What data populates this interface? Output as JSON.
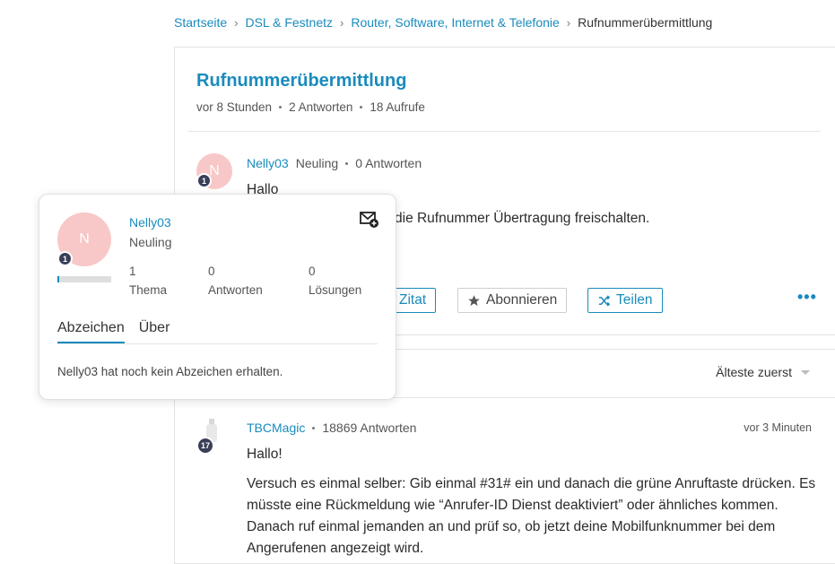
{
  "breadcrumb": {
    "items": [
      "Startseite",
      "DSL & Festnetz",
      "Router, Software, Internet & Telefonie"
    ],
    "current": "Rufnummerübermittlung",
    "separator": "›"
  },
  "thread": {
    "title": "Rufnummerübermittlung",
    "time": "vor 8 Stunden",
    "replies": "2 Antworten",
    "views": "18 Aufrufe"
  },
  "post": {
    "avatar_letter": "N",
    "rank_number": "1",
    "author": "Nelly03",
    "rank": "Neuling",
    "answers": "0 Antworten",
    "line1": "Hallo",
    "line2": "die Rufnummer Übertragung freischalten.",
    "buttons": {
      "quote": "Zitat",
      "subscribe": "Abonnieren",
      "share": "Teilen"
    },
    "more": "•••"
  },
  "replies_section": {
    "sort_label": "Älteste zuerst"
  },
  "reply": {
    "rank_number": "17",
    "author": "TBCMagic",
    "answers": "18869 Antworten",
    "time": "vor 3 Minuten",
    "greeting": "Hallo!",
    "line1": "Versuch es einmal selber: Gib einmal #31# ein und danach die grüne Anruftaste drücken. Es",
    "line2": "müsste eine Rückmeldung wie “Anrufer-ID Dienst deaktiviert” oder ähnliches kommen.",
    "line3": "Danach ruf einmal jemanden an und prüf so, ob jetzt deine Mobilfunknummer bei dem",
    "line4": "Angerufenen angezeigt wird."
  },
  "popover": {
    "avatar_letter": "N",
    "rank_number": "1",
    "name": "Nelly03",
    "rank": "Neuling",
    "stats": [
      {
        "value": "1",
        "label": "Thema"
      },
      {
        "value": "0",
        "label": "Antworten"
      },
      {
        "value": "0",
        "label": "Lösungen"
      }
    ],
    "tabs": [
      "Abzeichen",
      "Über"
    ],
    "empty_text": "Nelly03 hat noch kein Abzeichen erhalten."
  },
  "colors": {
    "accent": "#1a8bbd",
    "avatar_pink": "#f8c7c7",
    "rank_badge": "#3a3f58"
  }
}
